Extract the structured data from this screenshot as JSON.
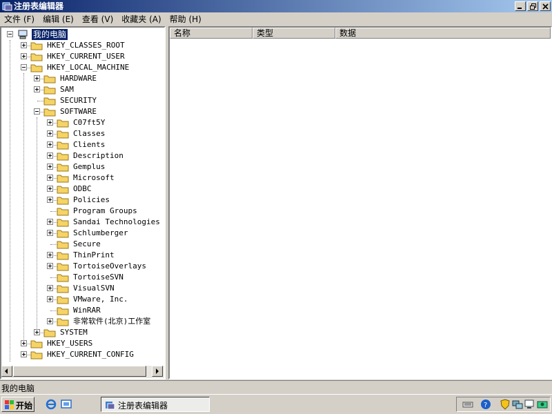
{
  "window": {
    "title": "注册表编辑器"
  },
  "menu": [
    "文件 (F)",
    "编辑 (E)",
    "查看 (V)",
    "收藏夹 (A)",
    "帮助 (H)"
  ],
  "tree": {
    "root": "我的电脑",
    "hives": {
      "classes_root": "HKEY_CLASSES_ROOT",
      "current_user": "HKEY_CURRENT_USER",
      "local_machine": "HKEY_LOCAL_MACHINE",
      "users": "HKEY_USERS",
      "current_config": "HKEY_CURRENT_CONFIG"
    },
    "hklm": [
      "HARDWARE",
      "SAM",
      "SECURITY",
      "SOFTWARE",
      "SYSTEM"
    ],
    "software": [
      "C07ft5Y",
      "Classes",
      "Clients",
      "Description",
      "Gemplus",
      "Microsoft",
      "ODBC",
      "Policies",
      "Program Groups",
      "Sandai Technologies Inc",
      "Schlumberger",
      "Secure",
      "ThinPrint",
      "TortoiseOverlays",
      "TortoiseSVN",
      "VisualSVN",
      "VMware, Inc.",
      "WinRAR",
      "非常软件(北京)工作室"
    ]
  },
  "list": {
    "columns": [
      "名称",
      "类型",
      "数据"
    ]
  },
  "status": {
    "text": "我的电脑"
  },
  "taskbar": {
    "start": "开始",
    "task": "注册表编辑器"
  },
  "colors": {
    "title_start": "#0a246a",
    "title_end": "#a6caf0",
    "selection": "#0a246a",
    "folder": "#f6d365"
  }
}
